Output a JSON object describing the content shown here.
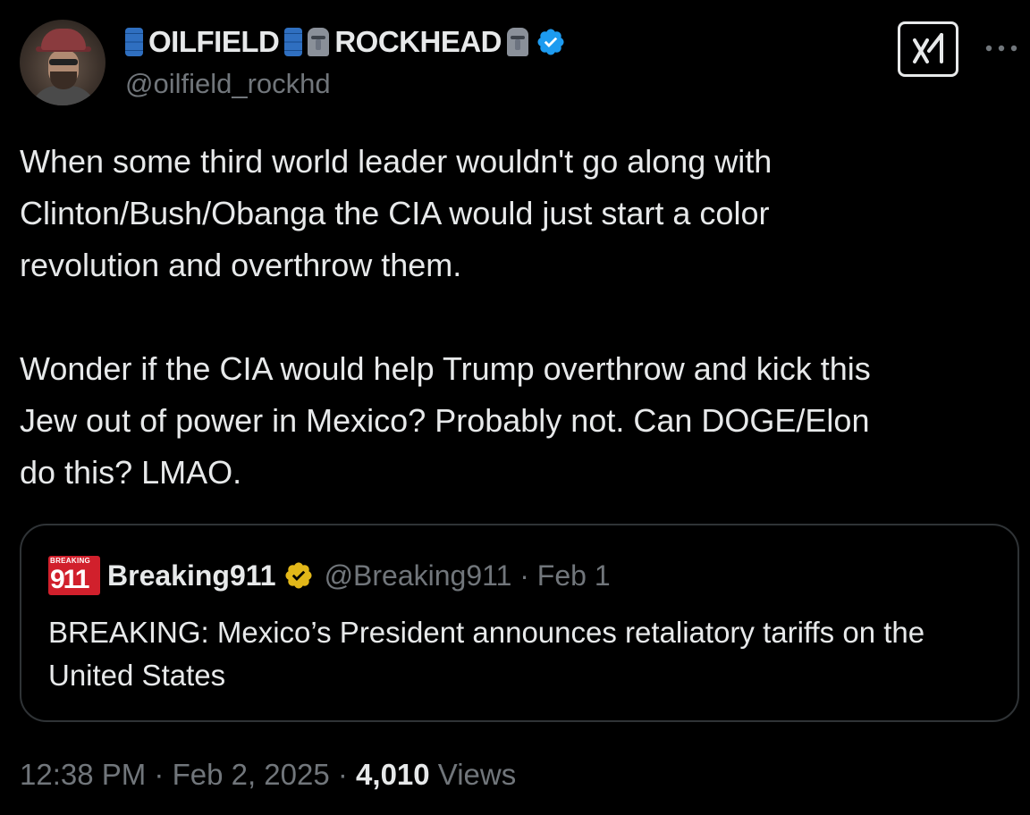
{
  "author": {
    "display_name_part1": "OILFIELD",
    "display_name_part2": "ROCKHEAD",
    "name_emoji": [
      "barrel-icon",
      "moai-icon"
    ],
    "verified_icon": "verified-badge-icon",
    "handle": "@oilfield_rockhd"
  },
  "tweet": {
    "text": "When some third world leader wouldn't go along with\nClinton/Bush/Obanga the CIA would just start a color\nrevolution and overthrow them.\n\nWonder if the CIA would help Trump overthrow and kick this\nJew out of power in Mexico? Probably not. Can DOGE/Elon\ndo this? LMAO."
  },
  "quote": {
    "logo_small": "BREAKING",
    "logo_big": "911",
    "name": "Breaking911",
    "badge_icon": "gold-verified-badge-icon",
    "handle_date": "@Breaking911 · Feb 1",
    "text": "BREAKING: Mexico’s President announces retaliatory tariffs on the United States"
  },
  "meta": {
    "time_date": "12:38 PM · Feb 2, 2025 · ",
    "views_count": "4,010",
    "views_label": " Views"
  },
  "colors": {
    "background": "#000000",
    "text": "#e7e9ea",
    "muted": "#71767b",
    "border": "#2f3336",
    "verified_blue": "#1d9bf0",
    "verified_gold": "#e2b719",
    "breaking_red": "#d1202c"
  }
}
